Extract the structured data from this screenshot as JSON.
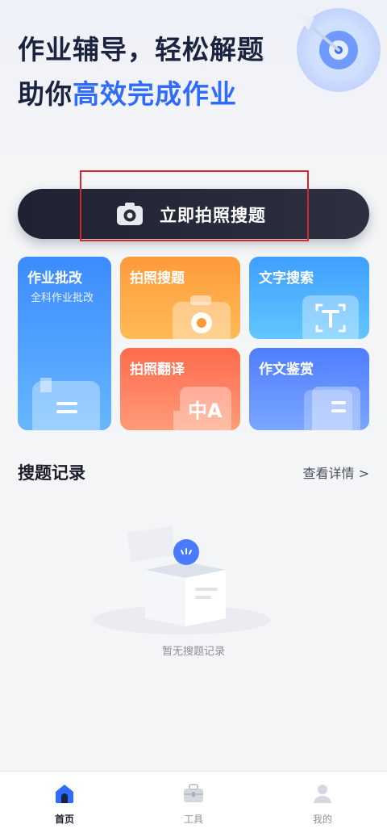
{
  "hero": {
    "line1": "作业辅导，轻松解题",
    "line2_prefix": "助你",
    "line2_highlight": "高效完成作业",
    "decor_icon": "target-arrow-icon"
  },
  "cta": {
    "label": "立即拍照搜题",
    "icon": "camera-icon"
  },
  "features": [
    {
      "title": "作业批改",
      "subtitle": "全科作业批改",
      "icon": "document-icon"
    },
    {
      "title": "拍照搜题",
      "icon": "camera-icon"
    },
    {
      "title": "文字搜索",
      "icon": "text-scan-icon"
    },
    {
      "title": "拍照翻译",
      "icon": "translate-icon"
    },
    {
      "title": "作文鉴赏",
      "icon": "book-icon"
    }
  ],
  "history": {
    "title": "搜题记录",
    "more": "查看详情 >",
    "empty_text": "暂无搜题记录",
    "empty_icon": "empty-box-icon"
  },
  "tabbar": [
    {
      "label": "首页",
      "icon": "home-icon",
      "active": true
    },
    {
      "label": "工具",
      "icon": "toolbox-icon",
      "active": false
    },
    {
      "label": "我的",
      "icon": "user-icon",
      "active": false
    }
  ],
  "colors": {
    "accent": "#2f6bff",
    "cta_bg": "#1e2232",
    "highlight_box": "#d7262e",
    "card_zuoye": "#3c8bff",
    "card_paizhao": "#ff9a3b",
    "card_wenzi": "#3f9fff",
    "card_fanyi": "#ff6a4c",
    "card_zuowen": "#4f7dff"
  }
}
